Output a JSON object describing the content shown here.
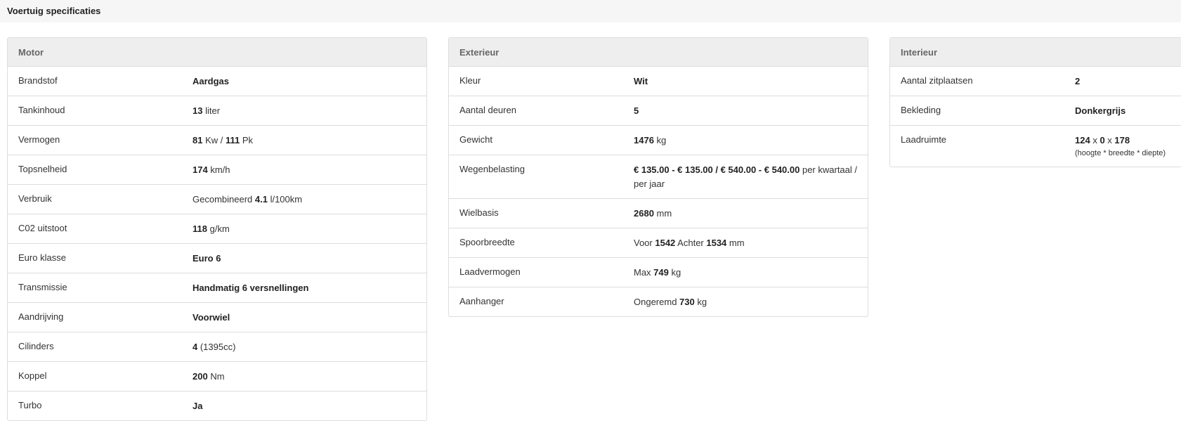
{
  "page": {
    "title": "Voertuig specificaties"
  },
  "motor": {
    "title": "Motor",
    "rows": [
      {
        "label": "Brandstof",
        "parts": [
          {
            "t": "Aardgas",
            "b": true
          }
        ]
      },
      {
        "label": "Tankinhoud",
        "parts": [
          {
            "t": "13",
            "b": true
          },
          {
            "t": " liter",
            "b": false
          }
        ]
      },
      {
        "label": "Vermogen",
        "parts": [
          {
            "t": "81",
            "b": true
          },
          {
            "t": " Kw / ",
            "b": false
          },
          {
            "t": "111",
            "b": true
          },
          {
            "t": " Pk",
            "b": false
          }
        ]
      },
      {
        "label": "Topsnelheid",
        "parts": [
          {
            "t": "174",
            "b": true
          },
          {
            "t": " km/h",
            "b": false
          }
        ]
      },
      {
        "label": "Verbruik",
        "parts": [
          {
            "t": "Gecombineerd ",
            "b": false
          },
          {
            "t": "4.1",
            "b": true
          },
          {
            "t": " l/100km",
            "b": false
          }
        ]
      },
      {
        "label": "C02 uitstoot",
        "parts": [
          {
            "t": "118",
            "b": true
          },
          {
            "t": " g/km",
            "b": false
          }
        ]
      },
      {
        "label": "Euro klasse",
        "parts": [
          {
            "t": "Euro 6",
            "b": true
          }
        ]
      },
      {
        "label": "Transmissie",
        "parts": [
          {
            "t": "Handmatig 6 versnellingen",
            "b": true
          }
        ]
      },
      {
        "label": "Aandrijving",
        "parts": [
          {
            "t": "Voorwiel",
            "b": true
          }
        ]
      },
      {
        "label": "Cilinders",
        "parts": [
          {
            "t": "4",
            "b": true
          },
          {
            "t": " (1395cc)",
            "b": false
          }
        ]
      },
      {
        "label": "Koppel",
        "parts": [
          {
            "t": "200",
            "b": true
          },
          {
            "t": " Nm",
            "b": false
          }
        ]
      },
      {
        "label": "Turbo",
        "parts": [
          {
            "t": "Ja",
            "b": true
          }
        ]
      }
    ]
  },
  "exterieur": {
    "title": "Exterieur",
    "rows": [
      {
        "label": "Kleur",
        "parts": [
          {
            "t": "Wit",
            "b": true
          }
        ]
      },
      {
        "label": "Aantal deuren",
        "parts": [
          {
            "t": "5",
            "b": true
          }
        ]
      },
      {
        "label": "Gewicht",
        "parts": [
          {
            "t": "1476",
            "b": true
          },
          {
            "t": " kg",
            "b": false
          }
        ]
      },
      {
        "label": "Wegenbelasting",
        "parts": [
          {
            "t": "€ 135.00 - € 135.00 / € 540.00 - € 540.00",
            "b": true
          },
          {
            "t": " per kwartaal / per jaar",
            "b": false
          }
        ]
      },
      {
        "label": "Wielbasis",
        "parts": [
          {
            "t": "2680",
            "b": true
          },
          {
            "t": " mm",
            "b": false
          }
        ]
      },
      {
        "label": "Spoorbreedte",
        "parts": [
          {
            "t": "Voor ",
            "b": false
          },
          {
            "t": "1542",
            "b": true
          },
          {
            "t": " Achter ",
            "b": false
          },
          {
            "t": "1534",
            "b": true
          },
          {
            "t": " mm",
            "b": false
          }
        ]
      },
      {
        "label": "Laadvermogen",
        "parts": [
          {
            "t": "Max ",
            "b": false
          },
          {
            "t": "749",
            "b": true
          },
          {
            "t": " kg",
            "b": false
          }
        ]
      },
      {
        "label": "Aanhanger",
        "parts": [
          {
            "t": "Ongeremd ",
            "b": false
          },
          {
            "t": "730",
            "b": true
          },
          {
            "t": " kg",
            "b": false
          }
        ]
      }
    ]
  },
  "interieur": {
    "title": "Interieur",
    "rows": [
      {
        "label": "Aantal zitplaatsen",
        "parts": [
          {
            "t": "2",
            "b": true
          }
        ]
      },
      {
        "label": "Bekleding",
        "parts": [
          {
            "t": "Donkergrijs",
            "b": true
          }
        ]
      },
      {
        "label": "Laadruimte",
        "parts": [
          {
            "t": "124",
            "b": true
          },
          {
            "t": " x ",
            "b": false
          },
          {
            "t": "0",
            "b": true
          },
          {
            "t": " x ",
            "b": false
          },
          {
            "t": "178",
            "b": true
          }
        ],
        "sub": "(hoogte * breedte * diepte)"
      }
    ]
  }
}
